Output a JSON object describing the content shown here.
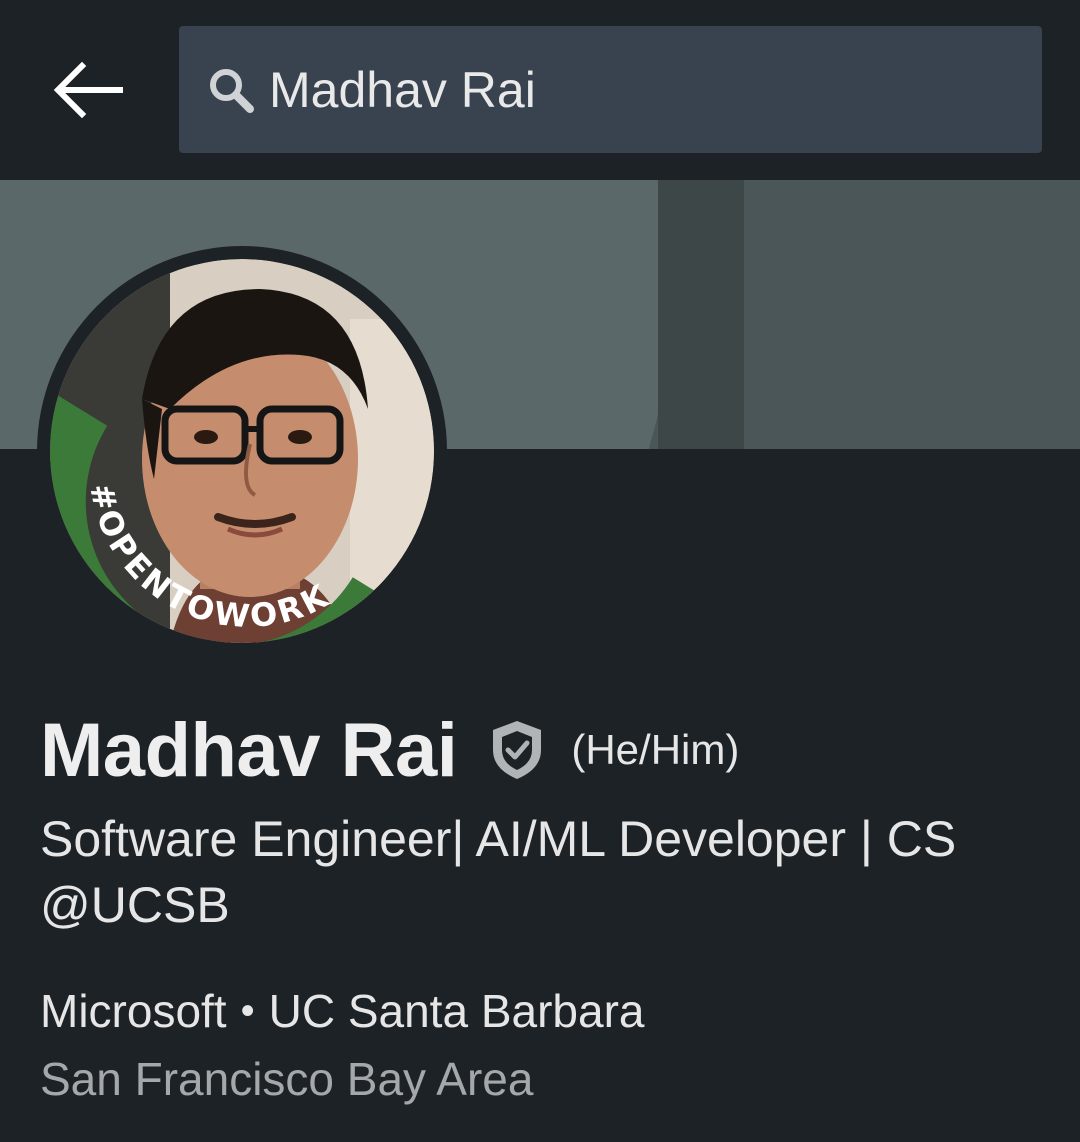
{
  "header": {
    "back_icon": "arrow-left-icon",
    "search_icon": "search-icon",
    "search_value": "Madhav Rai"
  },
  "profile": {
    "name": "Madhav Rai",
    "verified_icon": "verified-shield-icon",
    "pronouns": "(He/Him)",
    "headline": "Software Engineer| AI/ML Developer | CS @UCSB",
    "company": "Microsoft",
    "separator": "•",
    "school": "UC Santa Barbara",
    "location": "San Francisco Bay Area",
    "open_to_work_badge": "#OPENTOWORK",
    "badge_color": "#2e6b30"
  }
}
